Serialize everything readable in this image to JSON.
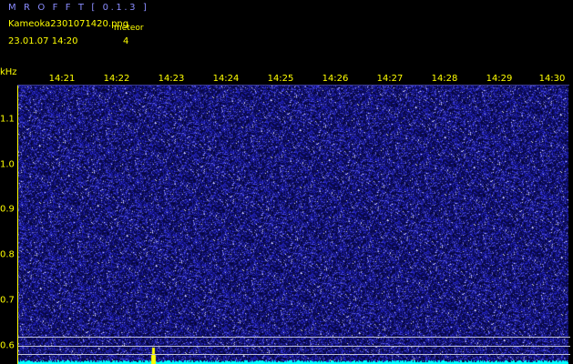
{
  "header": {
    "app_title": "M R O F F T [ 0.1.3 ]",
    "file_name": "Kameoka2301071420.png",
    "meteor_label": "meteor",
    "timestamp": "23.01.07 14:20",
    "meteor_count": "4"
  },
  "axis": {
    "unit": "kHz",
    "time_ticks": [
      "14:21",
      "14:22",
      "14:23",
      "14:24",
      "14:25",
      "14:26",
      "14:27",
      "14:28",
      "14:29",
      "14:30"
    ],
    "freq_ticks": [
      "1.1",
      "1.0",
      "0.9",
      "0.8",
      "0.7",
      "0.6"
    ]
  },
  "colors": {
    "background": "#000000",
    "noise_dark": "#05054a",
    "noise_mid": "#2222cc",
    "noise_bright": "#8c8cff",
    "label": "#ffff00",
    "signal_trace": "#00ffff",
    "meteor_echo": "#ffff00",
    "reference_line": "#c0c0d8"
  }
}
